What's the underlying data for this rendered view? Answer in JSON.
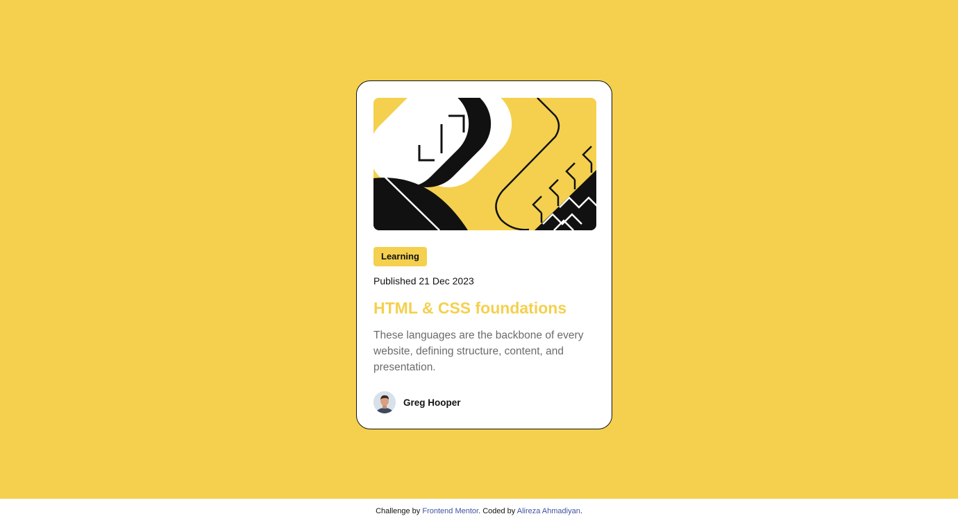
{
  "card": {
    "tag": "Learning",
    "published": "Published 21 Dec 2023",
    "title": "HTML & CSS foundations",
    "description": "These languages are the backbone of every website, defining structure, content, and presentation.",
    "author": {
      "name": "Greg Hooper"
    }
  },
  "footer": {
    "prefix": "Challenge by ",
    "challenge_link": "Frontend Mentor",
    "middle": ". Coded by ",
    "author_link": "Alireza Ahmadiyan",
    "suffix": "."
  },
  "colors": {
    "background": "#f4d04e",
    "card": "#ffffff",
    "text_dark": "#111111",
    "text_muted": "#6b6b6b",
    "link": "#3e52a3"
  },
  "icons": {
    "illustration": "article-illustration",
    "avatar": "author-avatar"
  }
}
